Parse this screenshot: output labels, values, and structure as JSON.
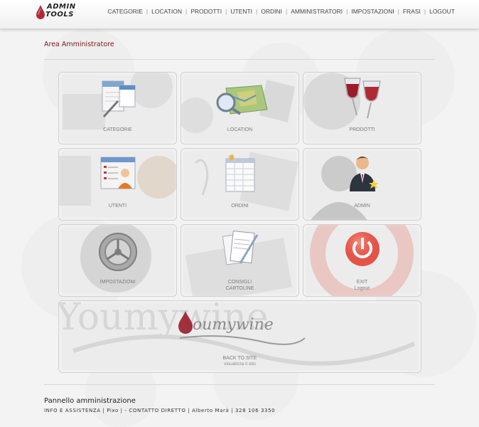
{
  "header": {
    "logo_text_1": "ADMIN",
    "logo_text_2": "TOOLS",
    "nav": [
      "CATEGORIE",
      "LOCATION",
      "PRODOTTI",
      "UTENTI",
      "ORDINI",
      "AMMINISTRATORI",
      "IMPOSTAZIONI",
      "FRASI",
      "LOGOUT"
    ]
  },
  "main": {
    "title": "Area Amministratore",
    "tiles": [
      {
        "label": "CATEGORIE",
        "icon": "categories-icon"
      },
      {
        "label": "LOCATION",
        "icon": "map-icon"
      },
      {
        "label": "PRODOTTI",
        "icon": "wine-glasses-icon"
      },
      {
        "label": "UTENTI",
        "icon": "users-icon"
      },
      {
        "label": "ORDINI",
        "icon": "orders-icon"
      },
      {
        "label": "ADMIN",
        "icon": "admin-icon"
      },
      {
        "label": "IMPOSTAZIONI",
        "icon": "settings-icon"
      },
      {
        "label": "CONSIGLI",
        "label2": "CARTOLINE",
        "icon": "notes-icon"
      },
      {
        "label": "EXIT",
        "label2": "Logout",
        "icon": "power-icon"
      }
    ],
    "back": {
      "brand": "oumywine",
      "label": "BACK TO SITE",
      "sublabel": "visualizza il sito"
    }
  },
  "footer": {
    "title": "Pannello amministrazione",
    "info": "INFO E ASSISTENZA | Pixo | - CONTATTO DIRETTO | Alberto Marà | 328 106 3350"
  },
  "colors": {
    "accent": "#7a1a1a",
    "wine": "#b02a35"
  }
}
